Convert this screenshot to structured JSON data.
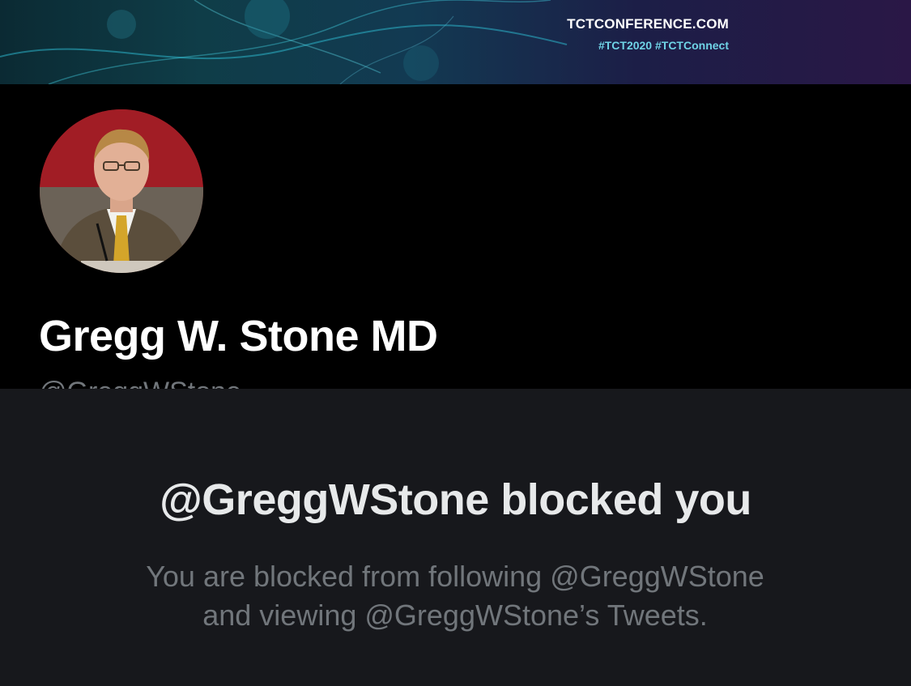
{
  "banner": {
    "site": "TCTCONFERENCE.COM",
    "hashtags": "#TCT2020 #TCTConnect"
  },
  "profile": {
    "display_name": "Gregg W. Stone MD",
    "handle": "@GreggWStone",
    "avatar_icon": "profile-photo"
  },
  "blocked": {
    "title": "@GreggWStone blocked you",
    "desc_line1": "You are blocked from following @GreggWStone",
    "desc_line2": "and viewing @GreggWStone’s Tweets."
  },
  "colors": {
    "background": "#000000",
    "panel": "#17181c",
    "primary_text": "#e7e9ea",
    "secondary_text": "#71767b",
    "banner_accent": "#6fd3e6"
  }
}
